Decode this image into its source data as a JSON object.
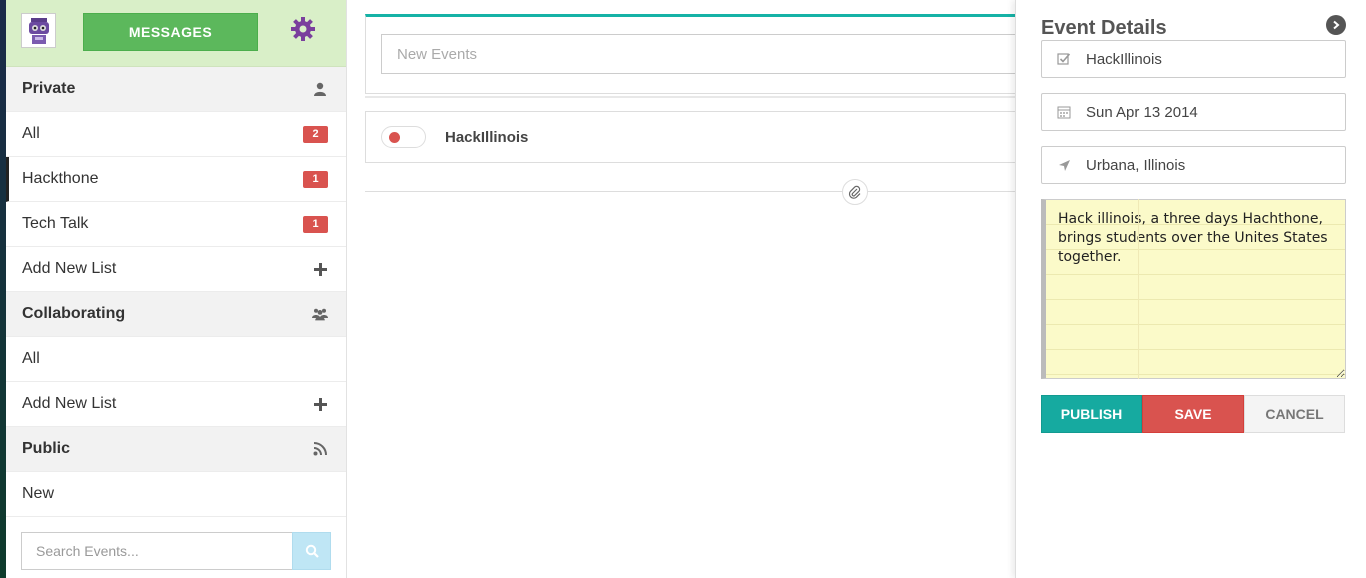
{
  "sidebar": {
    "messages_label": "MESSAGES",
    "sections": [
      {
        "title": "Private",
        "icon": "user-icon"
      },
      {
        "title": "Collaborating",
        "icon": "users-icon"
      },
      {
        "title": "Public",
        "icon": "rss-icon"
      }
    ],
    "private_items": [
      {
        "label": "All",
        "badge": "2"
      },
      {
        "label": "Hackthone",
        "badge": "1"
      },
      {
        "label": "Tech Talk",
        "badge": "1"
      },
      {
        "label": "Add New List"
      }
    ],
    "collab_items": [
      {
        "label": "All"
      },
      {
        "label": "Add New List"
      }
    ],
    "public_items": [
      {
        "label": "New"
      }
    ],
    "search_placeholder": "Search Events..."
  },
  "main": {
    "new_event_placeholder": "New Events",
    "events": [
      {
        "title": "HackIllinois"
      }
    ]
  },
  "details": {
    "title": "Event Details",
    "name": "HackIllinois",
    "date": "Sun Apr 13 2014",
    "location": "Urbana, Illinois",
    "description": "Hack illinois, a three days Hachthone, brings students over the Unites States  together.",
    "publish_label": "PUBLISH",
    "save_label": "SAVE",
    "cancel_label": "CANCEL"
  },
  "colors": {
    "accent_teal": "#16aaa0",
    "danger_red": "#d9534f",
    "success_green": "#5cb85c",
    "header_green": "#d9efc8",
    "gear_purple": "#7a3f9d"
  }
}
